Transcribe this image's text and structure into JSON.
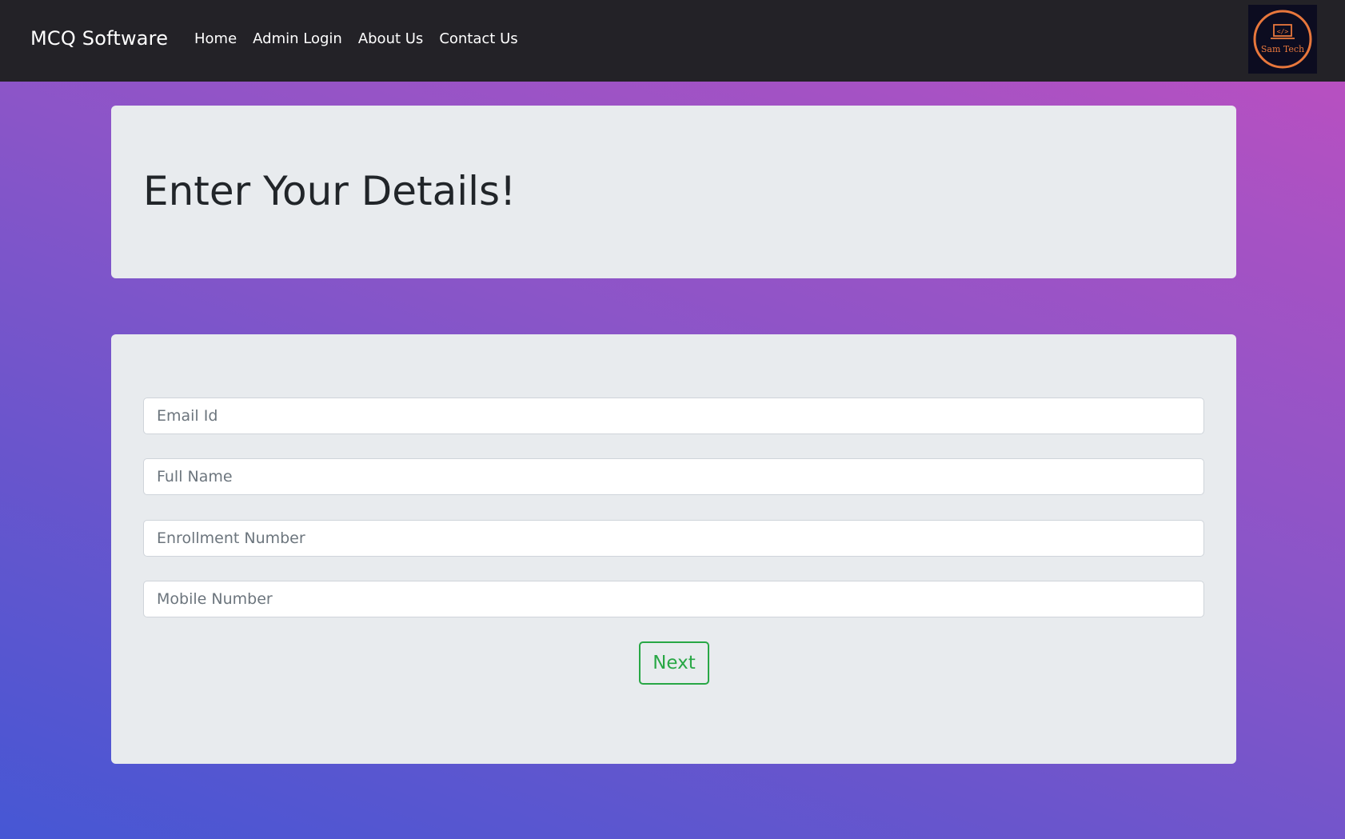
{
  "navbar": {
    "brand": "MCQ Software",
    "links": [
      {
        "label": "Home"
      },
      {
        "label": "Admin Login"
      },
      {
        "label": "About Us"
      },
      {
        "label": "Contact Us"
      }
    ],
    "logo": {
      "text": "Sam Tech",
      "icon": "laptop-code-icon"
    }
  },
  "header": {
    "title": "Enter Your Details!"
  },
  "form": {
    "fields": [
      {
        "placeholder": "Email Id",
        "value": ""
      },
      {
        "placeholder": "Full Name",
        "value": ""
      },
      {
        "placeholder": "Enrollment Number",
        "value": ""
      },
      {
        "placeholder": "Mobile Number",
        "value": ""
      }
    ],
    "submit_label": "Next"
  },
  "colors": {
    "navbar_bg": "#232227",
    "card_bg": "#e8ebee",
    "button_accent": "#28a745",
    "logo_accent": "#e8773c",
    "gradient_start": "#4657d4",
    "gradient_end": "#c04fbf"
  }
}
